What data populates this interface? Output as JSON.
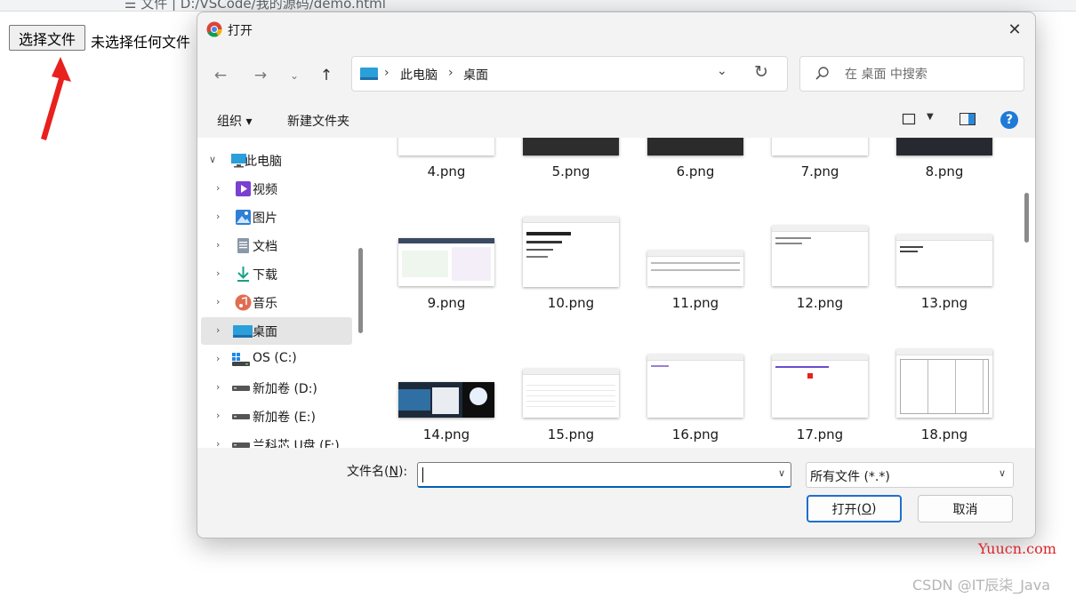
{
  "browser": {
    "address_text": "☰ 文件 | D:/VSCode/我的源码/demo.html",
    "file_button_label": "选择文件",
    "file_status": "未选择任何文件"
  },
  "dialog": {
    "title": "打开",
    "close_glyph": "✕",
    "breadcrumb": [
      "此电脑",
      "桌面"
    ],
    "search_placeholder": "在 桌面 中搜索",
    "organize_label": "组织 ▾",
    "new_folder_label": "新建文件夹",
    "help_glyph": "?",
    "nav_items": [
      {
        "label": "此电脑",
        "icon": "monitor-icon",
        "expanded": true
      },
      {
        "label": "视频",
        "icon": "video-icon"
      },
      {
        "label": "图片",
        "icon": "picture-icon"
      },
      {
        "label": "文档",
        "icon": "document-icon"
      },
      {
        "label": "下载",
        "icon": "download-icon"
      },
      {
        "label": "音乐",
        "icon": "music-icon"
      },
      {
        "label": "桌面",
        "icon": "desktop-icon",
        "selected": true
      },
      {
        "label": "OS (C:)",
        "icon": "os-drive-icon"
      },
      {
        "label": "新加卷 (D:)",
        "icon": "drive-icon"
      },
      {
        "label": "新加卷 (E:)",
        "icon": "drive-icon"
      },
      {
        "label": "兰科芯 U盘 (F:)",
        "icon": "usb-drive-icon"
      }
    ],
    "files": [
      "4.png",
      "5.png",
      "6.png",
      "7.png",
      "8.png",
      "9.png",
      "10.png",
      "11.png",
      "12.png",
      "13.png",
      "14.png",
      "15.png",
      "16.png",
      "17.png",
      "18.png"
    ],
    "filename_label": "文件名(",
    "filename_key": "N",
    "filename_label_end": "):",
    "filename_value": "",
    "filetype_value": "所有文件 (*.*)",
    "open_label": "打开(",
    "open_key": "O",
    "open_label_end": ")",
    "cancel_label": "取消"
  },
  "watermarks": {
    "site": "Yuucn.com",
    "author": "CSDN @IT辰柒_Java"
  },
  "colors": {
    "accent": "#1f6fcc",
    "arrow": "#e8201e",
    "selected_nav": "#e5e5e5"
  }
}
